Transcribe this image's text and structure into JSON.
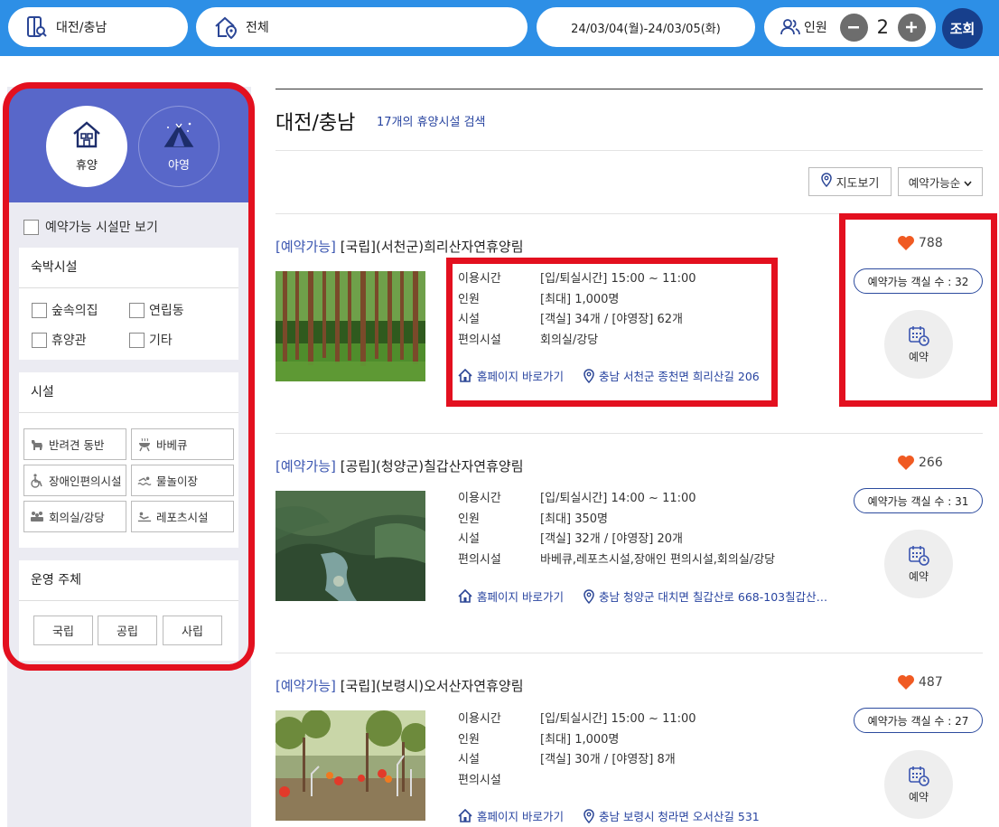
{
  "search": {
    "region": "대전/충남",
    "facility_type": "전체",
    "dates": "24/03/04(월)-24/03/05(화)",
    "people_label": "인원",
    "people_count": "2",
    "submit_label": "조회"
  },
  "sidebar": {
    "tabs": [
      {
        "label": "휴양",
        "icon": "house-icon",
        "active": true
      },
      {
        "label": "야영",
        "icon": "tent-icon",
        "active": false
      }
    ],
    "only_available_label": "예약가능 시설만 보기",
    "lodging": {
      "title": "숙박시설",
      "options": [
        "숲속의집",
        "연립동",
        "휴양관",
        "기타"
      ]
    },
    "facilities": {
      "title": "시설",
      "items": [
        {
          "label": "반려견 동반",
          "icon": "dog-icon"
        },
        {
          "label": "바베큐",
          "icon": "grill-icon"
        },
        {
          "label": "장애인편의시설",
          "icon": "wheelchair-icon"
        },
        {
          "label": "물놀이장",
          "icon": "swim-icon"
        },
        {
          "label": "회의실/강당",
          "icon": "meeting-icon"
        },
        {
          "label": "레포츠시설",
          "icon": "sports-icon"
        }
      ]
    },
    "operator": {
      "title": "운영 주체",
      "options": [
        "국립",
        "공립",
        "사립"
      ]
    }
  },
  "results": {
    "region_title": "대전/충남",
    "count_text": "17개의 휴양시설 검색",
    "map_button": "지도보기",
    "sort_selected": "예약가능순",
    "labels": {
      "use_time": "이용시간",
      "capacity": "인원",
      "facility": "시설",
      "amenities": "편의시설",
      "homepage": "홈페이지 바로가기",
      "reserve": "예약"
    },
    "items": [
      {
        "badge": "[예약가능]",
        "name": "[국립](서천군)희리산자연휴양림",
        "use_time": "[입/퇴실시간] 15:00 ~ 11:00",
        "capacity": "[최대] 1,000명",
        "facility": "[객실] 34개 / [야영장] 62개",
        "amenities": "회의실/강당",
        "address": "충남 서천군 종천면 희리산길 206",
        "likes": "788",
        "available_rooms": "예약가능 객실 수 : 32"
      },
      {
        "badge": "[예약가능]",
        "name": "[공립](청양군)칠갑산자연휴양림",
        "use_time": "[입/퇴실시간] 14:00 ~ 11:00",
        "capacity": "[최대] 350명",
        "facility": "[객실] 32개 / [야영장] 20개",
        "amenities": "바베큐,레포츠시설,장애인 편의시설,회의실/강당",
        "address": "충남 청양군 대치면 칠갑산로 668-103칠갑산…",
        "likes": "266",
        "available_rooms": "예약가능 객실 수 : 31"
      },
      {
        "badge": "[예약가능]",
        "name": "[국립](보령시)오서산자연휴양림",
        "use_time": "[입/퇴실시간] 15:00 ~ 11:00",
        "capacity": "[최대] 1,000명",
        "facility": "[객실] 30개 / [야영장] 8개",
        "amenities": "",
        "address": "충남 보령시 청라면 오서산길 531",
        "likes": "487",
        "available_rooms": "예약가능 객실 수 : 27"
      }
    ]
  },
  "colors": {
    "topbar": "#2d8fe6",
    "sidebar_header": "#5867c9",
    "highlight_box": "#e3101f",
    "submit_button": "#173f8c",
    "link": "#2844a0",
    "heart": "#f05a22"
  }
}
